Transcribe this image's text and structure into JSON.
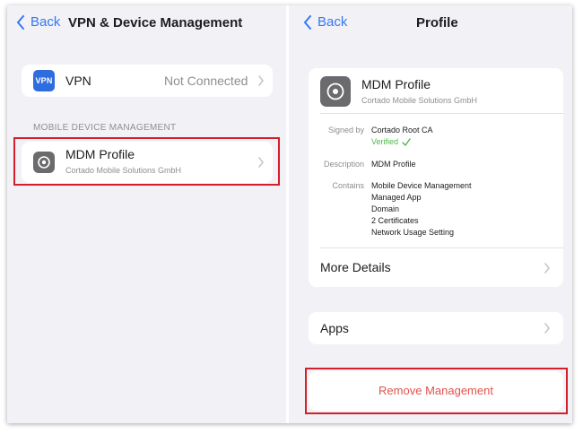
{
  "left": {
    "back_label": "Back",
    "title": "VPN & Device Management",
    "vpn": {
      "badge": "VPN",
      "label": "VPN",
      "status": "Not Connected"
    },
    "section_header": "MOBILE DEVICE MANAGEMENT",
    "mdm": {
      "name": "MDM Profile",
      "org": "Cortado Mobile Solutions GmbH"
    }
  },
  "right": {
    "back_label": "Back",
    "title": "Profile",
    "profile": {
      "name": "MDM Profile",
      "org": "Cortado Mobile Solutions GmbH"
    },
    "details": {
      "signed_by_label": "Signed by",
      "signed_by_value": "Cortado Root CA",
      "verified": "Verified",
      "description_label": "Description",
      "description_value": "MDM Profile",
      "contains_label": "Contains",
      "contains_items": [
        "Mobile Device Management",
        "Managed App",
        "Domain",
        "2 Certificates",
        "Network Usage Setting"
      ]
    },
    "more_details": "More Details",
    "apps": "Apps",
    "remove": "Remove Management"
  },
  "colors": {
    "accent": "#3478f6",
    "destructive": "#e0534d",
    "highlight": "#d21f2b",
    "verified": "#4cb84c"
  }
}
